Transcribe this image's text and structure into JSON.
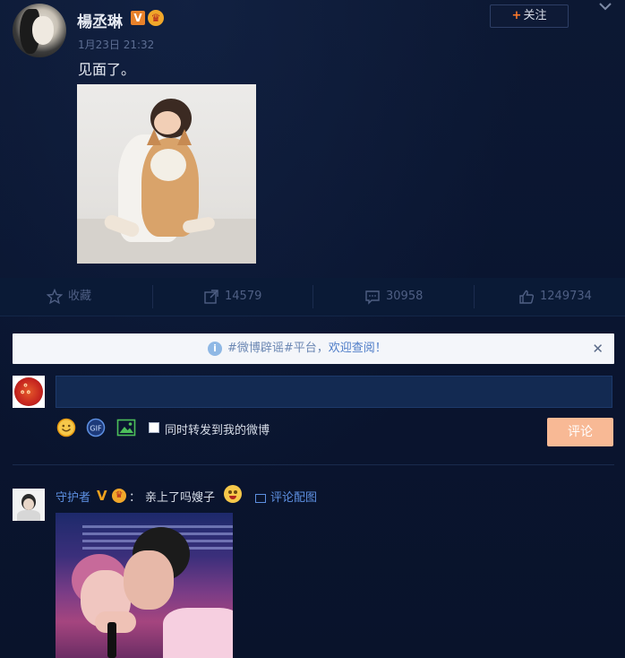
{
  "post": {
    "author": "楊丞琳",
    "follow_label": "关注",
    "timestamp": "1月23日 21:32",
    "text": "见面了。"
  },
  "actions": {
    "favorite_label": "收藏",
    "repost_count": "14579",
    "comment_count": "30958",
    "like_count": "1249734"
  },
  "notice": {
    "text": "#微博辟谣#平台，",
    "link": "欢迎查阅！"
  },
  "composer": {
    "input_value": "",
    "repost_option": "同时转发到我的微博",
    "repost_checked": false,
    "submit_label": "评论"
  },
  "comment": {
    "user": "守护者",
    "colon": "：",
    "text": "亲上了吗嫂子",
    "image_link": "评论配图"
  },
  "colors": {
    "background": "#0b1630",
    "link": "#5d8fe0",
    "accent": "#ff7a2a",
    "submit": "#f8b995"
  },
  "icons": [
    "star-icon",
    "repost-icon",
    "comment-icon",
    "like-icon",
    "info-icon",
    "close-icon",
    "emoji-icon",
    "gif-icon",
    "image-icon",
    "chevron-down-icon"
  ]
}
